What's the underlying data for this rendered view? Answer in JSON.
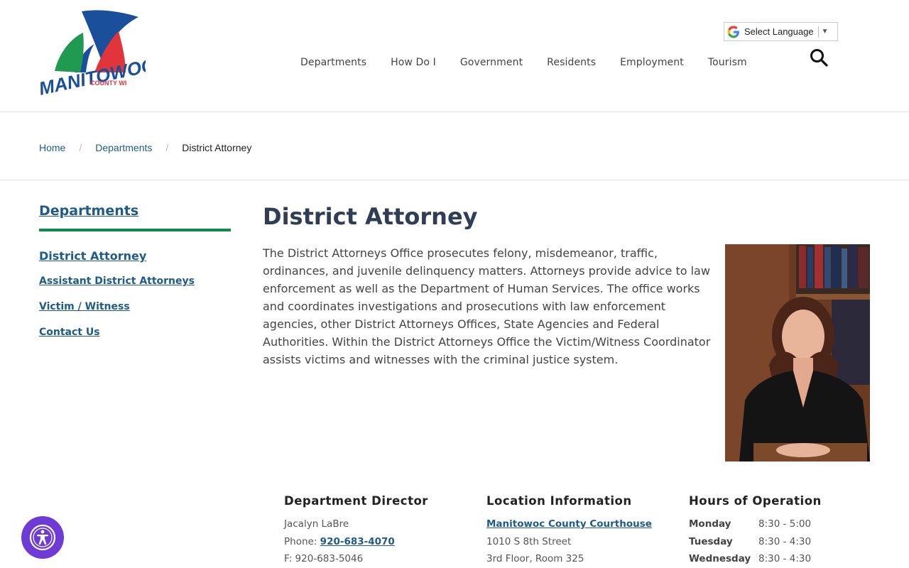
{
  "header": {
    "logo_text": "MANITOWOC",
    "logo_sub": "COUNTY WI",
    "language_label": "Select Language",
    "nav": [
      "Departments",
      "How Do I",
      "Government",
      "Residents",
      "Employment",
      "Tourism"
    ]
  },
  "breadcrumb": {
    "home": "Home",
    "departments": "Departments",
    "current": "District Attorney"
  },
  "sidebar": {
    "title": "Departments",
    "links": [
      "District Attorney",
      "Assistant District Attorneys",
      "Victim / Witness",
      "Contact Us"
    ]
  },
  "main": {
    "title": "District Attorney",
    "intro": "The District Attorneys Office prosecutes felony, misdemeanor, traffic, ordinances, and juvenile delinquency matters. Attorneys provide advice to law enforcement as well as the Department of Human Services. The office works and coordinates investigations and prosecutions with law enforcement agencies, other District Attorneys Offices, State Agencies and Federal Authorities.  Within the District Attorneys Office the Victim/Witness Coordinator assists victims and witnesses with the criminal justice system."
  },
  "director": {
    "heading": "Department Director",
    "name": "Jacalyn LaBre",
    "phone_label": "Phone: ",
    "phone": "920-683-4070",
    "fax": "F: 920-683-5046"
  },
  "location": {
    "heading": "Location Information",
    "building": "Manitowoc County Courthouse",
    "street": "1010 S 8th Street",
    "floor": "3rd Floor, Room 325"
  },
  "hours": {
    "heading": "Hours of Operation",
    "rows": [
      {
        "day": "Monday",
        "time": "8:30 - 5:00"
      },
      {
        "day": "Tuesday",
        "time": "8:30 - 4:30"
      },
      {
        "day": "Wednesday",
        "time": "8:30 - 4:30"
      }
    ]
  },
  "colors": {
    "link": "#1f5b8a",
    "accent_green": "#0e8a4e",
    "heading": "#2f3e55",
    "a11y_purple": "#6e3bd6"
  }
}
